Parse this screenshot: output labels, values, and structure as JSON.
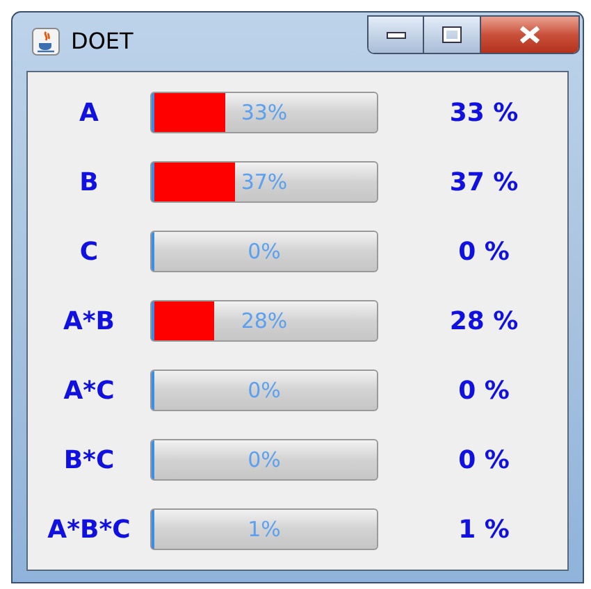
{
  "window": {
    "title": "DOET"
  },
  "rows": [
    {
      "label": "A",
      "bar_text": "33%",
      "level": 0.33,
      "value": "33 %"
    },
    {
      "label": "B",
      "bar_text": "37%",
      "level": 0.37,
      "value": "37 %"
    },
    {
      "label": "C",
      "bar_text": "0%",
      "level": 0,
      "value": "0 %"
    },
    {
      "label": "A*B",
      "bar_text": "28%",
      "level": 0.28,
      "value": "28 %"
    },
    {
      "label": "A*C",
      "bar_text": "0%",
      "level": 0,
      "value": "0 %"
    },
    {
      "label": "B*C",
      "bar_text": "0%",
      "level": 0,
      "value": "0 %"
    },
    {
      "label": "A*B*C",
      "bar_text": "1%",
      "level": 0.01,
      "value": "1 %"
    }
  ]
}
